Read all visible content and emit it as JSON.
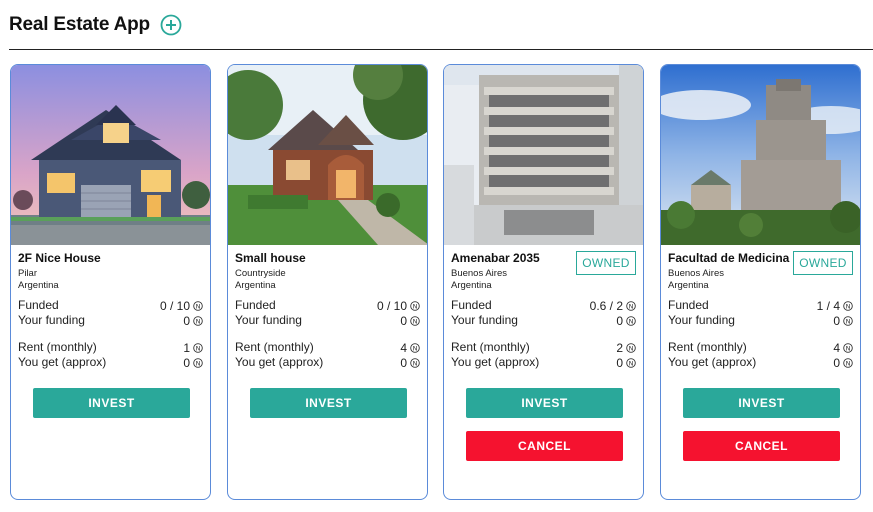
{
  "header": {
    "title": "Real Estate App",
    "add_icon": "plus-circle-icon"
  },
  "colors": {
    "accent": "#2aa89a",
    "cancel": "#f5122f",
    "card_border": "#5b8bd9"
  },
  "labels": {
    "funded": "Funded",
    "your_funding": "Your funding",
    "rent": "Rent (monthly)",
    "you_get": "You get (approx)",
    "invest": "INVEST",
    "cancel": "CANCEL",
    "owned": "OWNED"
  },
  "properties": [
    {
      "name": "2F Nice House",
      "city": "Pilar",
      "country": "Argentina",
      "funded": "0 / 10",
      "your_funding": "0",
      "rent": "1",
      "you_get": "0",
      "owned": false
    },
    {
      "name": "Small house",
      "city": "Countryside",
      "country": "Argentina",
      "funded": "0 / 10",
      "your_funding": "0",
      "rent": "4",
      "you_get": "0",
      "owned": false
    },
    {
      "name": "Amenabar 2035",
      "city": "Buenos Aires",
      "country": "Argentina",
      "funded": "0.6 / 2",
      "your_funding": "0",
      "rent": "2",
      "you_get": "0",
      "owned": true
    },
    {
      "name": "Facultad de Medicina",
      "city": "Buenos Aires",
      "country": "Argentina",
      "funded": "1 / 4",
      "your_funding": "0",
      "rent": "4",
      "you_get": "0",
      "owned": true
    }
  ]
}
